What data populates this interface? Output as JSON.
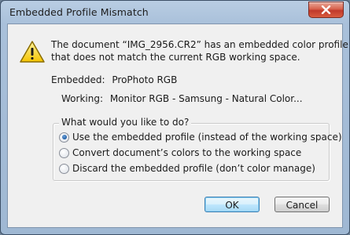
{
  "window": {
    "title": "Embedded Profile Mismatch"
  },
  "message": {
    "line1": "The document “IMG_2956.CR2” has an embedded color profile",
    "line2": "that does not match the current RGB working space."
  },
  "profiles": {
    "embedded_label": "Embedded:",
    "embedded_value": "ProPhoto RGB",
    "working_label": "Working:",
    "working_value": "Monitor RGB - Samsung - Natural Color..."
  },
  "options": {
    "legend": "What would you like to do?",
    "items": [
      {
        "label": "Use the embedded profile (instead of the working space)",
        "selected": true
      },
      {
        "label": "Convert document’s colors to the working space",
        "selected": false
      },
      {
        "label": "Discard the embedded profile (don’t color manage)",
        "selected": false
      }
    ]
  },
  "buttons": {
    "ok_label": "OK",
    "cancel_label": "Cancel"
  },
  "colors": {
    "warning_yellow": "#f5c400",
    "close_red": "#c0392b",
    "default_button_border": "#3c7fb1"
  },
  "icons": {
    "warning": "warning-icon",
    "close": "close-icon"
  }
}
